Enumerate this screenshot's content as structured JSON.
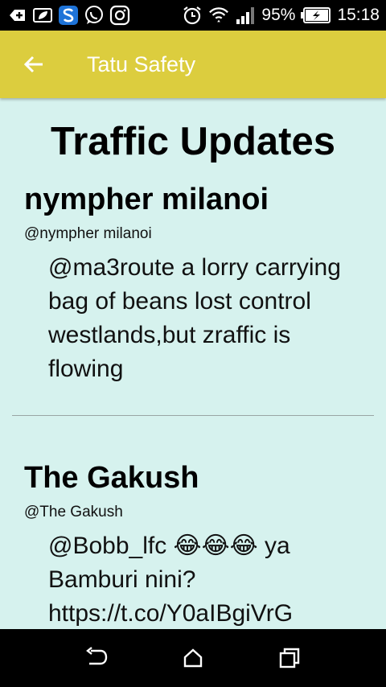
{
  "status_bar": {
    "battery": "95%",
    "time": "15:18",
    "icons": [
      "add-icon",
      "leaf-message-icon",
      "s-app-icon",
      "whatsapp-icon",
      "instagram-icon",
      "alarm-icon",
      "wifi-icon",
      "signal-icon",
      "battery-charging-icon"
    ]
  },
  "app_bar": {
    "title": "Tatu Safety",
    "background": "#dccd3e"
  },
  "main": {
    "title": "Traffic Updates",
    "tweets": [
      {
        "name": "nympher milanoi",
        "handle": "@nympher milanoi",
        "text": "@ma3route a lorry carrying bag of beans lost control westlands,but zraffic is flowing"
      },
      {
        "name": "The Gakush",
        "handle": "@The Gakush",
        "text": "@Bobb_lfc 😂😂😂 ya Bamburi nini? https://t.co/Y0aIBgiVrG"
      }
    ]
  },
  "colors": {
    "background": "#d6f2ee",
    "app_bar": "#dccd3e"
  }
}
